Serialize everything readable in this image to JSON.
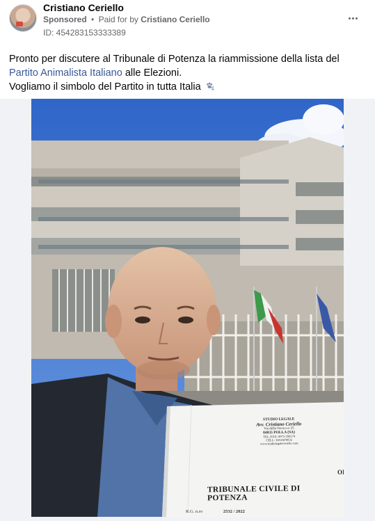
{
  "post": {
    "author": "Cristiano Ceriello",
    "sponsored_label": "Sponsored",
    "separator": "•",
    "paid_for_prefix": "Paid for by",
    "paid_for_name": "Cristiano Ceriello",
    "ad_id": "ID: 454283153333389",
    "more_icon": "more-horizontal-icon"
  },
  "text": {
    "line1_part1": "Pronto per discutere al Tribunale di Potenza la riammissione della lista del",
    "link": "Partito Animalista Italiano",
    "line2_part2": "alle Elezioni.",
    "line3": "Vogliamo il simbolo del Partito in tutta Italia",
    "emoji_icon": "paw-prints-icon"
  },
  "document": {
    "studio": "STUDIO LEGALE",
    "lawyer": "Avv. Cristiano Ceriello",
    "address1": "Via della Nova n.o 25",
    "address2": "84035 POLLA (SA)",
    "phone": "TEL./FAX: 0975-390174",
    "cell": "CELL: 328-8478832",
    "email": "www.studiolegaleceriello.com",
    "court": "TRIBUNALE CIVILE DI POTENZA",
    "rg_label": "R.G. n.ro",
    "rg_number": "2532 / 2022",
    "side_code": "OI"
  },
  "colors": {
    "link": "#385898",
    "secondary_text": "#65676b",
    "sky": "#3a6fc2"
  }
}
